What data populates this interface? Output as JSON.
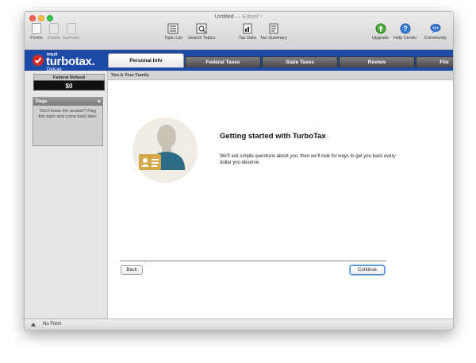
{
  "window": {
    "title": "Untitled",
    "edited": "— Edited ˅"
  },
  "toolbar": {
    "segments": [
      {
        "label": "Forms",
        "icon": "forms-icon"
      },
      {
        "label": "Details",
        "icon": "details-icon"
      },
      {
        "label": "Estimate",
        "icon": "estimate-icon"
      }
    ],
    "topic_list": "Topic List",
    "search_topics": "Search Topics",
    "tax_data": "Tax Data",
    "tax_summary": "Tax Summary",
    "upgrade": "Upgrade",
    "help_center": "Help Center",
    "community": "Community"
  },
  "logo": {
    "intuit": "intuit",
    "brand": "turbotax.",
    "edition": "Deluxe"
  },
  "tabs": [
    {
      "label": "Personal Info",
      "active": true
    },
    {
      "label": "Federal Taxes",
      "active": false
    },
    {
      "label": "State Taxes",
      "active": false
    },
    {
      "label": "Review",
      "active": false
    },
    {
      "label": "File",
      "active": false
    }
  ],
  "subnav": "You & Your Family",
  "sidebar": {
    "refund_label": "Federal Refund",
    "refund_value": "$0",
    "flags_title": "Flags",
    "flags_plus": "+",
    "flags_text": "Don't know the answer? Flag this topic and come back later."
  },
  "main": {
    "heading": "Getting started with TurboTax",
    "body": "We'll ask simple questions about you, then we'll look for ways to get you back every dollar you deserve.",
    "back": "Back",
    "continue": "Continue"
  },
  "status": {
    "text": "No Form"
  },
  "colors": {
    "brand_blue": "#1c4aa8",
    "logo_red": "#d52b1e",
    "illustration_bg": "#f0ece4",
    "illustration_shirt": "#2c6c86",
    "id_card": "#d5a849"
  }
}
